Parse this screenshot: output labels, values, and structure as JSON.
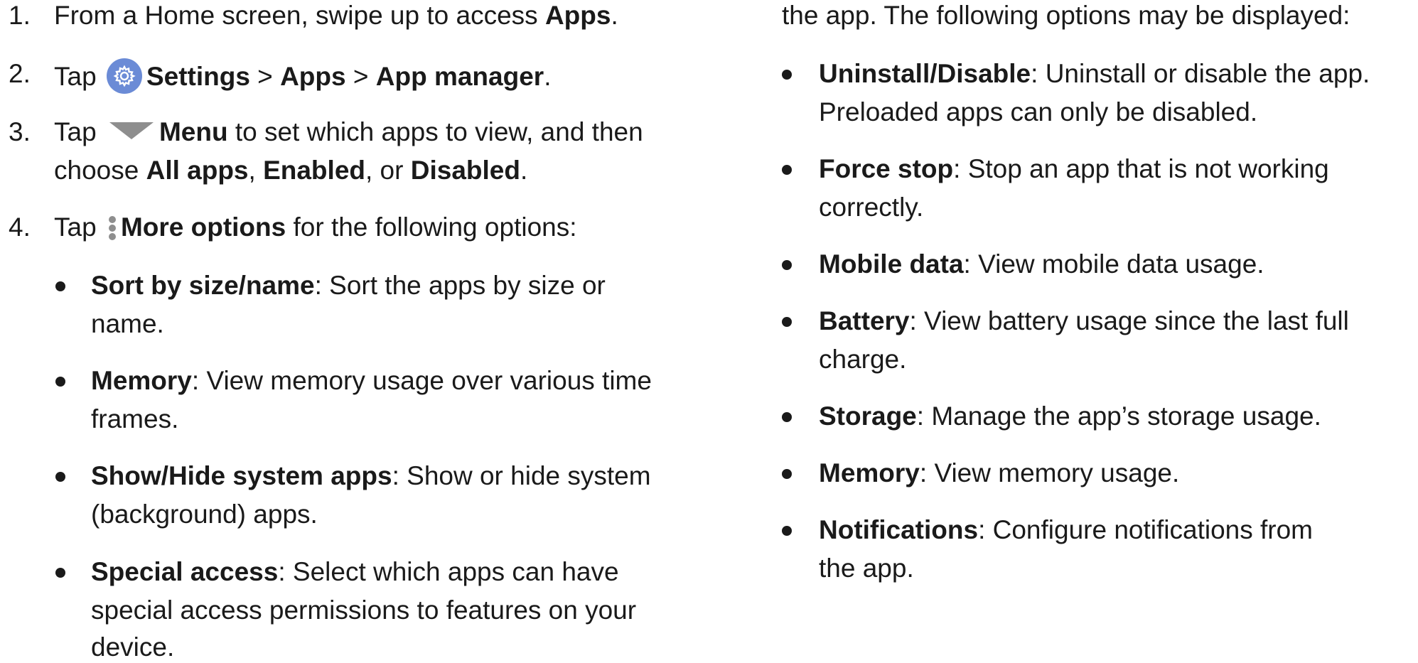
{
  "left": {
    "step1": {
      "num": "1.",
      "pre": "From a Home screen, swipe up to access ",
      "b1": "Apps",
      "post": "."
    },
    "step2": {
      "num": "2.",
      "pre": "Tap ",
      "b1": "Settings",
      "sep1": " > ",
      "b2": "Apps",
      "sep2": " > ",
      "b3": "App manager",
      "post": "."
    },
    "step3": {
      "num": "3.",
      "pre": "Tap ",
      "b1": "Menu",
      "post1": " to set which apps to view, and then",
      "l2pre": "choose ",
      "l2b1": "All apps",
      "l2sep1": ", ",
      "l2b2": "Enabled",
      "l2sep2": ", or ",
      "l2b3": "Disabled",
      "l2post": "."
    },
    "step4": {
      "num": "4.",
      "pre": "Tap ",
      "b1": "More options",
      "post": " for the following options:"
    },
    "bullets": [
      {
        "term": "Sort by size/name",
        "l1": ": Sort the apps by size or",
        "l2": "name."
      },
      {
        "term": "Memory",
        "l1": ": View memory usage over various time",
        "l2": "frames."
      },
      {
        "term": "Show/Hide system apps",
        "l1": ": Show or hide system",
        "l2": "(background) apps."
      },
      {
        "term": "Special access",
        "l1": ": Select which apps can have",
        "l2": "special access permissions to features on your",
        "l3": "device."
      }
    ]
  },
  "right": {
    "intro": "the app. The following options may be displayed:",
    "bullets": [
      {
        "term": "Uninstall/Disable",
        "l1": ": Uninstall or disable the app.",
        "l2": "Preloaded apps can only be disabled."
      },
      {
        "term": "Force stop",
        "l1": ": Stop an app that is not working",
        "l2": "correctly."
      },
      {
        "term": "Mobile data",
        "l1": ": View mobile data usage."
      },
      {
        "term": "Battery",
        "l1": ": View battery usage since the last full",
        "l2": "charge."
      },
      {
        "term": "Storage",
        "l1": ": Manage the app’s storage usage."
      },
      {
        "term": "Memory",
        "l1": ": View memory usage."
      },
      {
        "term": "Notifications",
        "l1": ": Configure notifications from",
        "l2": "the app."
      }
    ]
  },
  "icons": {
    "settings": "settings-gear-icon",
    "menu": "dropdown-triangle-icon",
    "more": "more-options-icon"
  },
  "colors": {
    "gear_bg": "#6b8bd6",
    "icon_gray": "#8e8e8e"
  }
}
